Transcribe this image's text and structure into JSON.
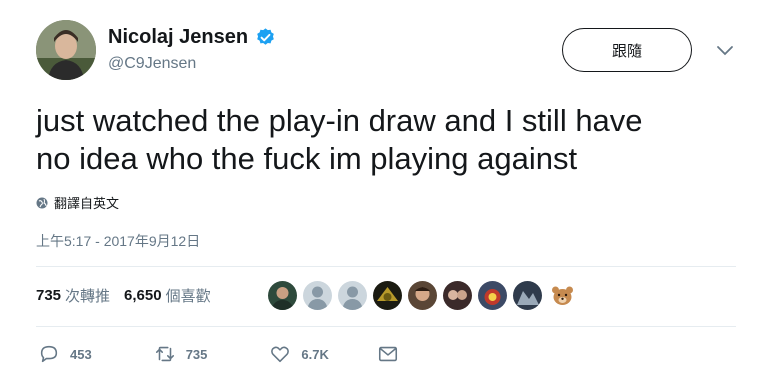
{
  "author": {
    "name": "Nicolaj Jensen",
    "handle": "@C9Jensen",
    "verified": true
  },
  "follow_button": {
    "label": "跟隨"
  },
  "tweet": {
    "text_line1": "just watched the play-in draw and I still have",
    "text_line2": "no idea who the fuck im playing against",
    "translate_label": "翻譯自英文",
    "timestamp": "上午5:17 - 2017年9月12日"
  },
  "stats": {
    "retweets_count": "735",
    "retweets_label": "次轉推",
    "likes_count": "6,650",
    "likes_label": "個喜歡"
  },
  "liker_avatars": [
    "photo",
    "default",
    "default",
    "photo",
    "photo",
    "photo",
    "photo",
    "photo",
    "bear-emoji"
  ],
  "actions": {
    "reply_count": "453",
    "retweet_count": "735",
    "like_count": "6.7K"
  },
  "colors": {
    "verified_blue": "#1da1f2",
    "text": "#14171a",
    "secondary": "#657786",
    "divider": "#e6ecf0"
  }
}
